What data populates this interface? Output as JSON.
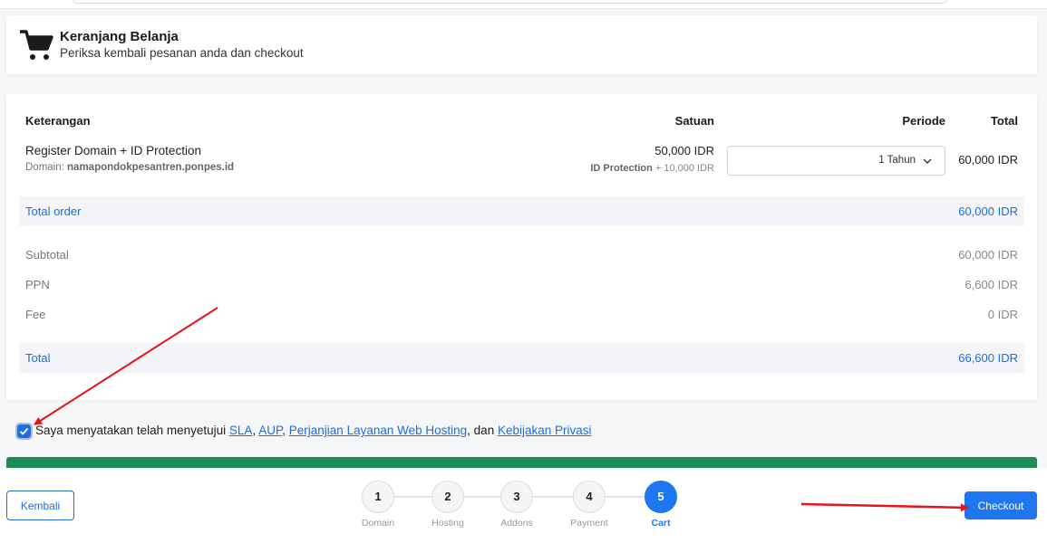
{
  "header": {
    "title": "Keranjang Belanja",
    "subtitle": "Periksa kembali pesanan anda dan checkout"
  },
  "table": {
    "columns": [
      "Keterangan",
      "Satuan",
      "Periode",
      "Total"
    ],
    "item": {
      "name": "Register Domain + ID Protection",
      "domain_label": "Domain:",
      "domain": "namapondokpesantren.ponpes.id",
      "unit_price": "50,000 IDR",
      "addon_label": "ID Protection",
      "addon_price": "+ 10,000 IDR",
      "period": "1 Tahun",
      "total": "60,000 IDR"
    }
  },
  "summary": {
    "total_order_label": "Total order",
    "total_order_value": "60,000 IDR",
    "subtotal_label": "Subtotal",
    "subtotal_value": "60,000 IDR",
    "ppn_label": "PPN",
    "ppn_value": "6,600 IDR",
    "fee_label": "Fee",
    "fee_value": "0 IDR",
    "total_label": "Total",
    "total_value": "66,600 IDR"
  },
  "agreement": {
    "checked": true,
    "prefix": "Saya menyatakan telah menyetujui",
    "link_sla": "SLA",
    "sep1": ",",
    "link_aup": "AUP",
    "sep2": ",",
    "link_perjanjian": "Perjanjian Layanan Web Hosting",
    "sep3": ", dan",
    "link_privasi": "Kebijakan Privasi"
  },
  "footer": {
    "back_label": "Kembali",
    "checkout_label": "Checkout",
    "steps": [
      {
        "number": "1",
        "label": "Domain"
      },
      {
        "number": "2",
        "label": "Hosting"
      },
      {
        "number": "3",
        "label": "Addons"
      },
      {
        "number": "4",
        "label": "Payment"
      },
      {
        "number": "5",
        "label": "Cart"
      }
    ],
    "active_step": 5
  },
  "colors": {
    "accent": "#1e77f0",
    "link": "#1e6fd9",
    "green_bar": "#1e8a55",
    "annotation_arrow": "#e5141a"
  },
  "icons": {
    "header": "shopping-cart-icon",
    "select": "chevron-down-icon",
    "checkbox": "checkmark-icon"
  }
}
